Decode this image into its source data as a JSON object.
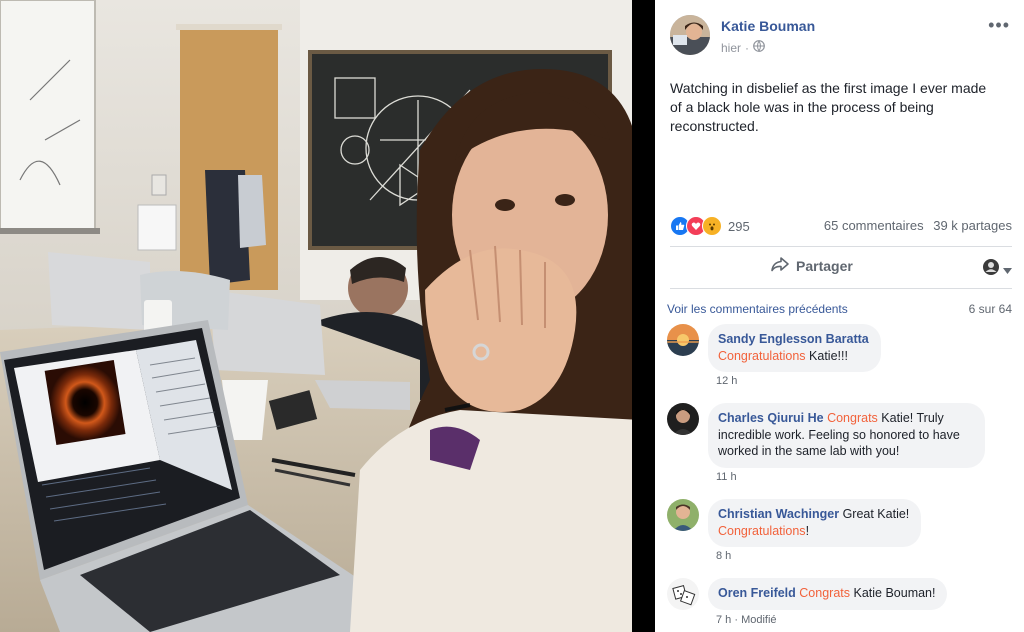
{
  "post": {
    "author": "Katie Bouman",
    "time": "hier",
    "text": "Watching in disbelief as the first image I ever made of a black hole was in the process of being reconstructed."
  },
  "stats": {
    "reaction_count": "295",
    "comments": "65 commentaires",
    "shares": "39 k partages"
  },
  "actions": {
    "share_label": "Partager"
  },
  "comments_section": {
    "view_previous": "Voir les commentaires précédents",
    "count": "6 sur 64",
    "items": [
      {
        "name": "Sandy Englesson Baratta",
        "highlight": "Congratulations",
        "text": " Katie!!!",
        "time": "12 h"
      },
      {
        "name": "Charles Qiurui He",
        "highlight": "Congrats",
        "text": " Katie! Truly incredible work. Feeling so honored to have worked in the same lab with you!",
        "time": "11 h"
      },
      {
        "name": "Christian Wachinger",
        "pre": " Great Katie!",
        "highlight": "Congratulations",
        "text": "!",
        "time": "8 h"
      },
      {
        "name": "Oren Freifeld",
        "highlight": "Congrats",
        "text": " Katie Bouman!",
        "time": "7 h",
        "edited": "Modifié"
      }
    ]
  },
  "colors": {
    "link": "#385898",
    "highlight": "#f2623b",
    "bubble": "#f2f3f5",
    "like": "#1877f2",
    "love": "#f33e58",
    "wow": "#f7b125"
  }
}
